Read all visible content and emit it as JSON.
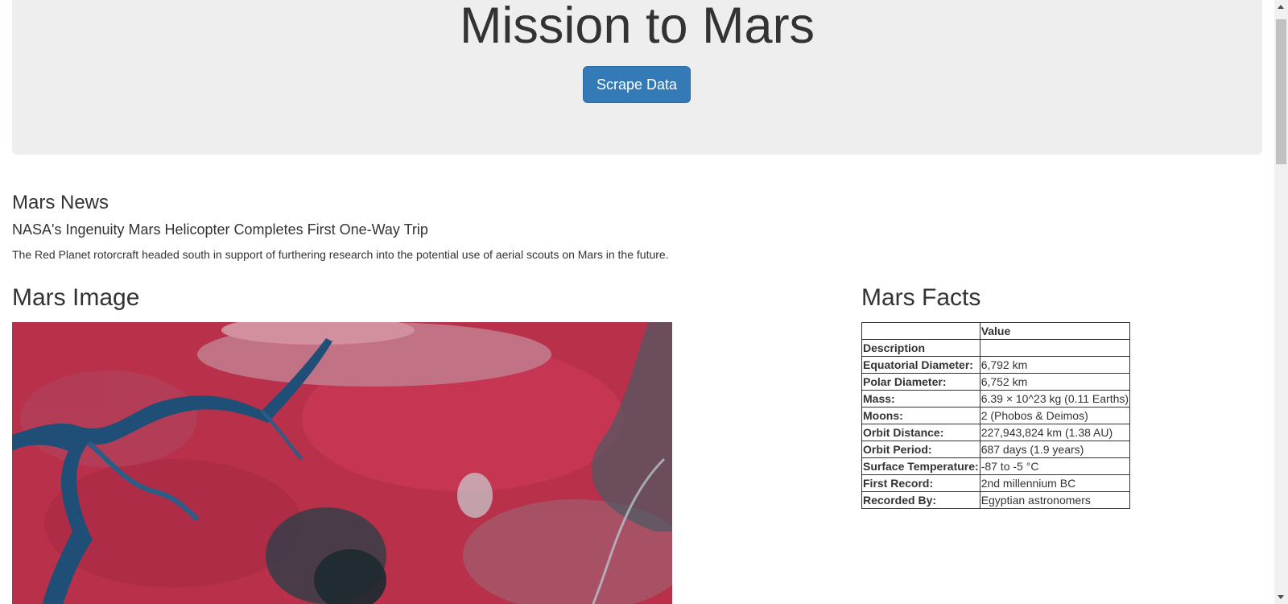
{
  "header": {
    "title": "Mission to Mars",
    "scrape_button_label": "Scrape Data"
  },
  "news": {
    "heading": "Mars News",
    "title": "NASA's Ingenuity Mars Helicopter Completes First One-Way Trip",
    "teaser": "The Red Planet rotorcraft headed south in support of furthering research into the potential use of aerial scouts on Mars in the future."
  },
  "image_section": {
    "heading": "Mars Image",
    "image_icon": "mars-surface-image"
  },
  "facts": {
    "heading": "Mars Facts",
    "columns": [
      "",
      "Value"
    ],
    "rows": [
      {
        "label": "Description",
        "value": ""
      },
      {
        "label": "Equatorial Diameter:",
        "value": "6,792 km"
      },
      {
        "label": "Polar Diameter:",
        "value": "6,752 km"
      },
      {
        "label": "Mass:",
        "value": "6.39 × 10^23 kg (0.11 Earths)"
      },
      {
        "label": "Moons:",
        "value": "2 (Phobos & Deimos)"
      },
      {
        "label": "Orbit Distance:",
        "value": "227,943,824 km (1.38 AU)"
      },
      {
        "label": "Orbit Period:",
        "value": "687 days (1.9 years)"
      },
      {
        "label": "Surface Temperature:",
        "value": "-87 to -5 °C"
      },
      {
        "label": "First Record:",
        "value": "2nd millennium BC"
      },
      {
        "label": "Recorded By:",
        "value": "Egyptian astronomers"
      }
    ]
  },
  "colors": {
    "button": "#337ab7",
    "jumbotron": "#eeeeee",
    "text": "#333333"
  }
}
